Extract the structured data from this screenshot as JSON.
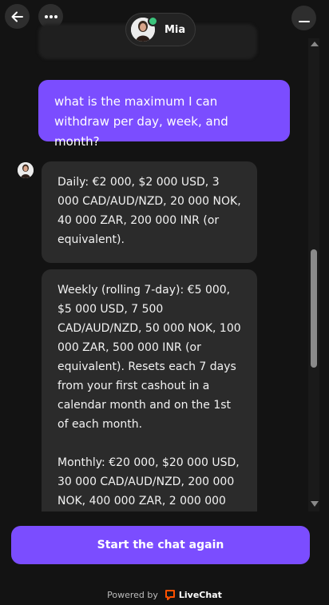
{
  "header": {
    "agent_name": "Mia",
    "back_icon": "arrow-left-icon",
    "menu_icon": "more-horizontal-icon",
    "minimize_icon": "minimize-icon",
    "status_color": "#3bc47c"
  },
  "messages": {
    "user": "what is the maximum I can withdraw per day, week, and month?",
    "agent_daily": "Daily: €2 000, $2 000 USD, 3 000 CAD/AUD/NZD, 20 000 NOK, 40 000 ZAR, 200 000 INR (or equivalent).",
    "agent_weekly": "Weekly (rolling 7-day): €5 000, $5 000 USD, 7 500 CAD/AUD/NZD, 50 000 NOK, 100 000 ZAR, 500 000 INR (or equivalent). Resets each 7 days from your first cashout in a calendar month and on the 1st of each month.",
    "agent_monthly": "Monthly: €20 000, $20 000 USD, 30 000 CAD/AUD/NZD, 200 000 NOK, 400 000 ZAR, 2 000 000"
  },
  "actions": {
    "start_chat_again": "Start the chat again"
  },
  "footer": {
    "powered_by": "Powered by",
    "brand": "LiveChat",
    "brand_color": "#ff5100"
  },
  "colors": {
    "accent": "#7b4dff",
    "background": "#131313",
    "bubble": "#2b2b2b"
  }
}
